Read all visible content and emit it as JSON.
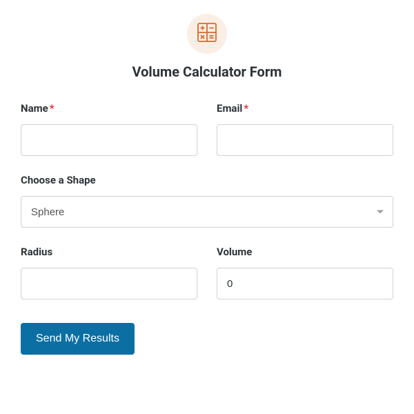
{
  "header": {
    "title": "Volume Calculator Form"
  },
  "fields": {
    "name": {
      "label": "Name",
      "required_mark": "*",
      "value": ""
    },
    "email": {
      "label": "Email",
      "required_mark": "*",
      "value": ""
    },
    "shape": {
      "label": "Choose a Shape",
      "selected": "Sphere"
    },
    "radius": {
      "label": "Radius",
      "value": ""
    },
    "volume": {
      "label": "Volume",
      "value": "0"
    }
  },
  "submit": {
    "label": "Send My Results"
  }
}
